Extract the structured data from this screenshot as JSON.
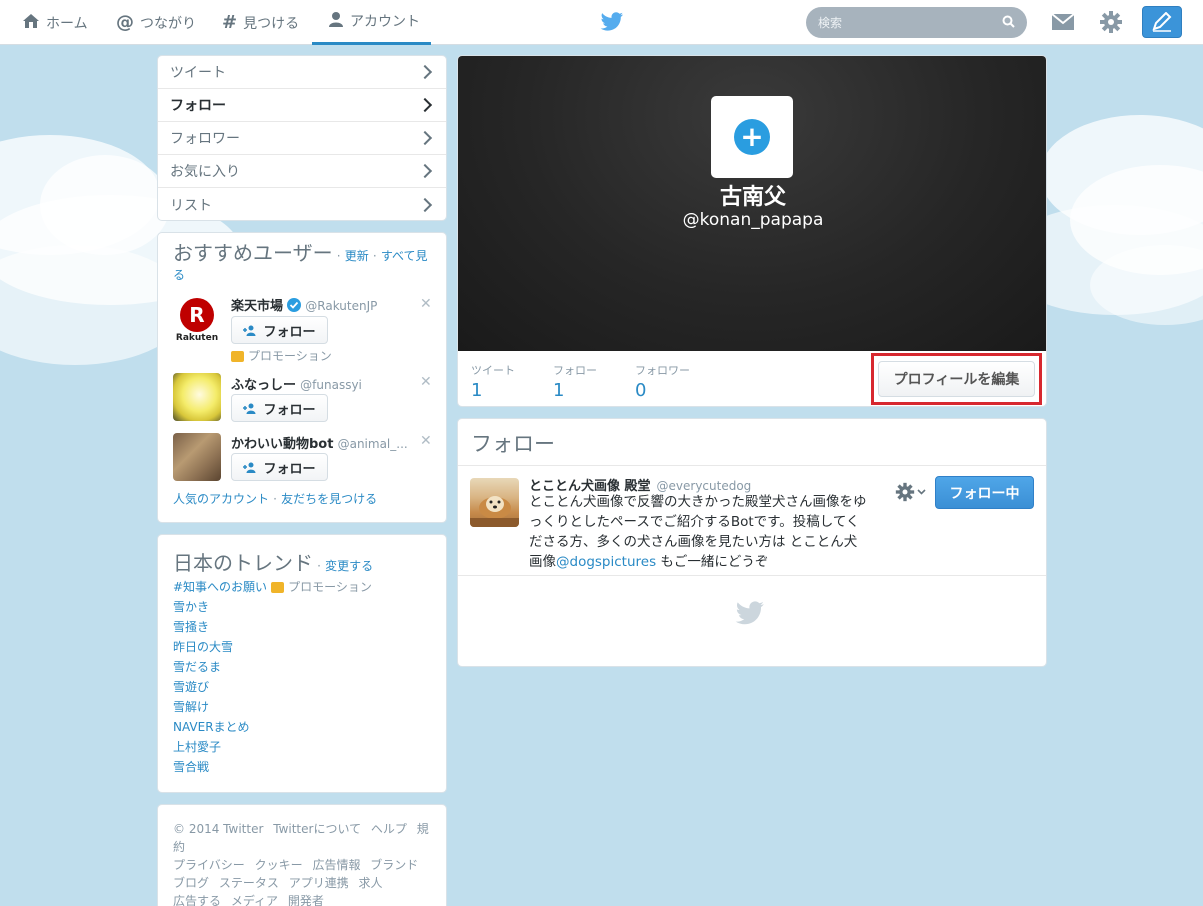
{
  "nav": {
    "items": [
      {
        "label": "ホーム",
        "icon": "home-icon"
      },
      {
        "label": "つながり",
        "icon": "at-icon"
      },
      {
        "label": "見つける",
        "icon": "hashtag-icon"
      },
      {
        "label": "アカウント",
        "icon": "person-icon"
      }
    ],
    "active_index": 3,
    "search_placeholder": "検索"
  },
  "sidebar_menu": [
    {
      "label": "ツイート"
    },
    {
      "label": "フォロー"
    },
    {
      "label": "フォロワー"
    },
    {
      "label": "お気に入り"
    },
    {
      "label": "リスト"
    }
  ],
  "recommend": {
    "title": "おすすめユーザー",
    "sep1": "·",
    "refresh": "更新",
    "sep2": "·",
    "see_all": "すべて見る",
    "users": [
      {
        "name": "楽天市場",
        "handle": "@RakutenJP",
        "verified": true,
        "button": "フォロー",
        "promoted": "プロモーション"
      },
      {
        "name": "ふなっしー",
        "handle": "@funassyi",
        "button": "フォロー"
      },
      {
        "name": "かわいい動物bot",
        "handle": "@animal_...",
        "button": "フォロー"
      }
    ],
    "popular_accounts": "人気のアカウント",
    "sep3": "·",
    "find_friends": "友だちを見つける"
  },
  "trends": {
    "title": "日本のトレンド",
    "sep": "·",
    "change": "変更する",
    "items": [
      "#知事へのお願い",
      "雪かき",
      "雪掻き",
      "昨日の大雪",
      "雪だるま",
      "雪遊び",
      "雪解け",
      "NAVERまとめ",
      "上村愛子",
      "雪合戦"
    ],
    "promoted_label": "プロモーション"
  },
  "footer": {
    "lines": [
      [
        "© 2014 Twitter",
        "Twitterについて",
        "ヘルプ",
        "規約"
      ],
      [
        "プライバシー",
        "クッキー",
        "広告情報",
        "ブランド"
      ],
      [
        "ブログ",
        "ステータス",
        "アプリ連携",
        "求人"
      ],
      [
        "広告する",
        "メディア",
        "開発者"
      ]
    ]
  },
  "profile": {
    "name": "古南父",
    "handle": "@konan_papapa",
    "stats": [
      {
        "label": "ツイート",
        "value": "1"
      },
      {
        "label": "フォロー",
        "value": "1"
      },
      {
        "label": "フォロワー",
        "value": "0"
      }
    ],
    "edit_button": "プロフィールを編集"
  },
  "following": {
    "title": "フォロー",
    "user": {
      "name": "とことん犬画像 殿堂",
      "handle": "@everycutedog",
      "bio_pre": "とことん犬画像で反響の大きかった殿堂犬さん画像をゆっくりとしたペースでご紹介するBotです。投稿してくださる方、多くの犬さん画像を見たい方は とことん犬画像",
      "bio_link": "@dogspictures",
      "bio_post": " もご一緒にどうぞ",
      "button": "フォロー中"
    }
  },
  "colors": {
    "accent": "#2a8ac5",
    "background": "#c0deed",
    "highlight_border": "#d7282f",
    "following_button": "#3b8fd5"
  }
}
